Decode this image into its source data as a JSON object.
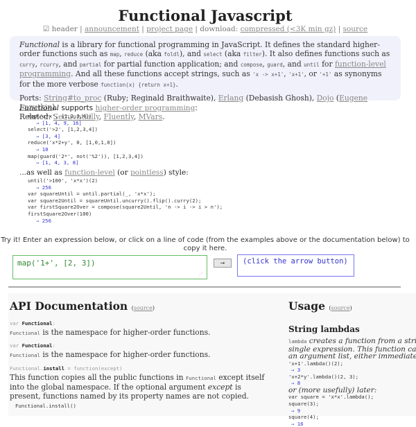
{
  "title": "Functional Javascript",
  "nav": {
    "checkbox_icon": "☑",
    "header_label": "header",
    "sep": "|",
    "announcement": "announcement",
    "project_page": "project page",
    "download_label": "download:",
    "compressed": "compressed (<3K min gz)",
    "source": "source"
  },
  "intro": {
    "p1": [
      {
        "t": "i",
        "v": "Functional"
      },
      {
        "t": "s",
        "v": " is a library for functional programming in JavaScript. It defines the standard higher-order functions such as "
      },
      {
        "t": "c",
        "v": "map"
      },
      {
        "t": "s",
        "v": ", "
      },
      {
        "t": "c",
        "v": "reduce"
      },
      {
        "t": "s",
        "v": " (aka "
      },
      {
        "t": "c",
        "v": "foldl"
      },
      {
        "t": "s",
        "v": "), and "
      },
      {
        "t": "c",
        "v": "select"
      },
      {
        "t": "s",
        "v": " (aka "
      },
      {
        "t": "c",
        "v": "filter"
      },
      {
        "t": "s",
        "v": "). It also defines functions such as "
      },
      {
        "t": "c",
        "v": "curry"
      },
      {
        "t": "s",
        "v": ", "
      },
      {
        "t": "c",
        "v": "rcurry"
      },
      {
        "t": "s",
        "v": ", and "
      },
      {
        "t": "c",
        "v": "partial"
      },
      {
        "t": "s",
        "v": " for partial function application; and "
      },
      {
        "t": "c",
        "v": "compose"
      },
      {
        "t": "s",
        "v": ", "
      },
      {
        "t": "c",
        "v": "guard"
      },
      {
        "t": "s",
        "v": ", and "
      },
      {
        "t": "c",
        "v": "until"
      },
      {
        "t": "s",
        "v": " for "
      },
      {
        "t": "a",
        "v": "function-level programming"
      },
      {
        "t": "s",
        "v": ". And all these functions accept strings, such as "
      },
      {
        "t": "c",
        "v": "'x -> x+1'"
      },
      {
        "t": "s",
        "v": ", "
      },
      {
        "t": "c",
        "v": "'x+1'"
      },
      {
        "t": "s",
        "v": ", or "
      },
      {
        "t": "c",
        "v": "'+1'"
      },
      {
        "t": "s",
        "v": " as synonyms for the more verbose "
      },
      {
        "t": "c",
        "v": "function(x) {return x+1}"
      },
      {
        "t": "s",
        "v": "."
      }
    ],
    "ports": [
      {
        "t": "s",
        "v": "Ports: "
      },
      {
        "t": "a",
        "v": "String#to_proc"
      },
      {
        "t": "s",
        "v": " (Ruby; Reginald Braithwaite), "
      },
      {
        "t": "a",
        "v": "Erlang"
      },
      {
        "t": "s",
        "v": " (Debasish Ghosh), "
      },
      {
        "t": "a",
        "v": "Dojo"
      },
      {
        "t": "s",
        "v": " ("
      },
      {
        "t": "a",
        "v": "Eugene Lazutkin"
      },
      {
        "t": "s",
        "v": ")."
      },
      {
        "t": "br",
        "v": ""
      },
      {
        "t": "s",
        "v": "Related: "
      },
      {
        "t": "a",
        "v": "Sequentially"
      },
      {
        "t": "s",
        "v": ", "
      },
      {
        "t": "a",
        "v": "Fluently"
      },
      {
        "t": "s",
        "v": ", "
      },
      {
        "t": "a",
        "v": "MVars"
      },
      {
        "t": "s",
        "v": "."
      }
    ]
  },
  "examples_hof": {
    "head_italic": "Functional",
    "head_text": " supports ",
    "head_link": "higher-order programming",
    "head_end": ":",
    "lines": [
      {
        "code": "map('x*x', [1,2,3,4])",
        "result": "→ [1, 4, 9, 16]"
      },
      {
        "code": "select('>2', [1,2,3,4])",
        "result": "→ [3, 4]"
      },
      {
        "code": "reduce('x*2+y', 0, [1,0,1,0])",
        "result": "→ 10"
      },
      {
        "code": "map(guard('2*', not('%2')), [1,2,3,4])",
        "result": "→ [1, 4, 3, 8]"
      }
    ]
  },
  "examples_fl": {
    "head_text": "...as well as ",
    "head_link1": "function-level",
    "head_mid": " (or ",
    "head_link2": "pointless",
    "head_end": ") style:",
    "lines": [
      {
        "code": "until('>100', 'x*x')(2)",
        "result": "→ 256"
      },
      {
        "code": "var squareUntil = until.partial(_, 'x*x');",
        "result": null
      },
      {
        "code": "var square2Until = squareUntil.uncurry().flip().curry(2);",
        "result": null
      },
      {
        "code": "var firstSquare2Over = compose(square2Until, 'n -> i -> i > n');",
        "result": null
      },
      {
        "code": "firstSquare2Over(100)",
        "result": "→ 256"
      }
    ]
  },
  "tryit": {
    "instructions": "Try it! Enter an expression below, or click on a line of code (from the examples above or the documentation below) to copy it here.",
    "input_value": "map('1+', [2, 3])",
    "run_button": "→",
    "output": "(click the arrow button)"
  },
  "api": {
    "heading": "API Documentation",
    "source_open": "(",
    "source_link": "source",
    "source_close": ")",
    "entries": [
      {
        "sig_prefix": "var ",
        "sig_name": "Functional",
        "sig_suffix": ":",
        "desc_code": "Functional",
        "desc": " is the namespace for higher-order functions."
      },
      {
        "sig_prefix": "var ",
        "sig_name": "Functional",
        "sig_suffix": ":",
        "desc_code": "Functional",
        "desc": " is the namespace for higher-order functions."
      }
    ],
    "install": {
      "sig_prefix": "Functional.",
      "sig_name": "install",
      "sig_suffix": " = function(except)",
      "desc1": "This function copies all the public functions in ",
      "desc_code": "Functional",
      "desc2": " except itself into the global namespace. If the optional argument ",
      "desc_em": "except",
      "desc3": " is present, functions named by its property names are not copied.",
      "example": "Functional.install()"
    }
  },
  "usage": {
    "heading": "Usage",
    "source_open": "(",
    "source_link": "source",
    "source_close": ")",
    "subheading": "String lambdas",
    "intro_code": "lambda",
    "intro_1": " creates a function from a string that contains a",
    "intro_2": "single expression. This function can then be applied to",
    "intro_3": "an argument list, either immediately:",
    "ex1_code": "'x+1'.lambda()(2);",
    "ex1_result": "→ 3",
    "ex2_code": "'x+2*y'.lambda()(2, 3);",
    "ex2_result": "→ 8",
    "later": "or (more usefully) later:",
    "ex3_code": "var square = 'x*x'.lambda();",
    "ex4_code": "square(3);",
    "ex4_result": "→ 9",
    "ex5_code": "square(4);",
    "ex5_result": "→ 16"
  }
}
